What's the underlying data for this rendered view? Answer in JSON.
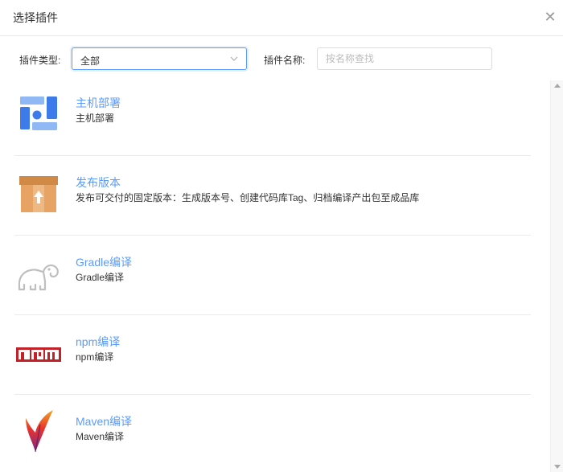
{
  "dialog": {
    "title": "选择插件",
    "close_icon": "close-icon"
  },
  "filters": {
    "type_label": "插件类型:",
    "type_value": "全部",
    "name_label": "插件名称:",
    "name_placeholder": "按名称查找",
    "name_value": ""
  },
  "plugins": [
    {
      "name": "主机部署",
      "description": "主机部署",
      "icon": "host-deploy-icon"
    },
    {
      "name": "发布版本",
      "description": "发布可交付的固定版本：生成版本号、创建代码库Tag、归档编译产出包至成品库",
      "icon": "release-box-icon"
    },
    {
      "name": "Gradle编译",
      "description": "Gradle编译",
      "icon": "gradle-elephant-icon"
    },
    {
      "name": "npm编译",
      "description": "npm编译",
      "icon": "npm-logo-icon"
    },
    {
      "name": "Maven编译",
      "description": "Maven编译",
      "icon": "maven-feather-icon"
    }
  ],
  "colors": {
    "accent": "#5b9bff",
    "npm_red": "#c12127",
    "box": "#e7a363"
  }
}
